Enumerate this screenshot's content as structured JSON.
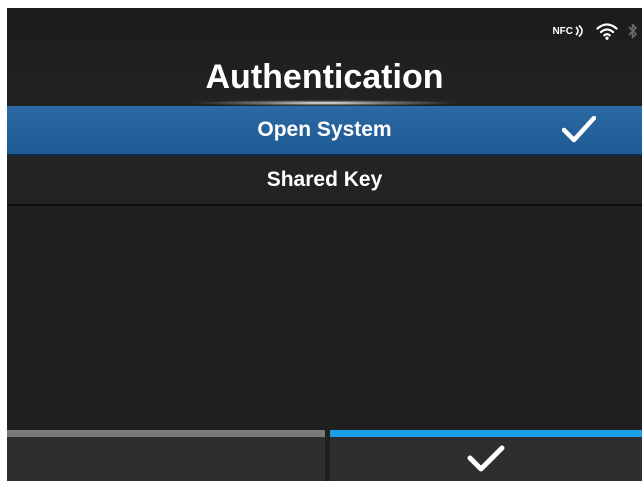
{
  "status_bar": {
    "nfc_label": "NFC",
    "icons": [
      "nfc-icon",
      "wifi-icon",
      "bluetooth-icon"
    ]
  },
  "header": {
    "title": "Authentication"
  },
  "menu": {
    "items": [
      {
        "label": "Open System",
        "selected": true,
        "checked": true
      },
      {
        "label": "Shared Key",
        "selected": false,
        "checked": false
      }
    ]
  },
  "softkeys": {
    "left": {
      "icon": ""
    },
    "right": {
      "icon": "check-icon"
    }
  },
  "colors": {
    "background": "#1f1f1f",
    "selection": "#1e5a94",
    "confirm_accent": "#1aa0e6",
    "inactive_accent": "#7a7a7a",
    "text": "#ffffff"
  }
}
